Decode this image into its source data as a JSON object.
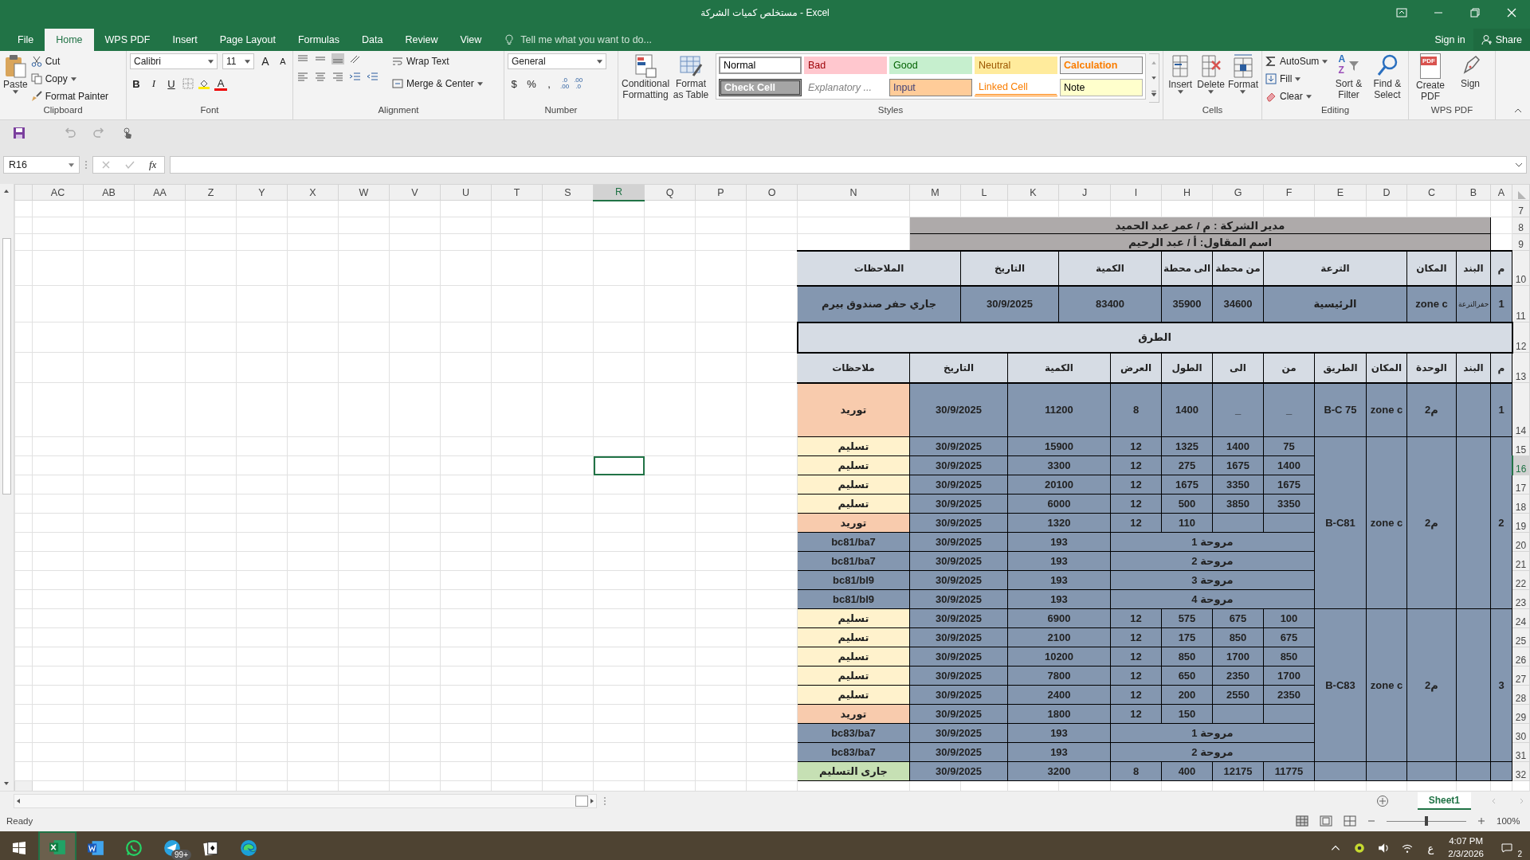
{
  "window": {
    "title": "مستخلص كميات الشركة - Excel"
  },
  "account": {
    "sign_in": "Sign in",
    "share": "Share"
  },
  "tabs": [
    {
      "label": "File",
      "selected": false
    },
    {
      "label": "Home",
      "selected": true
    },
    {
      "label": "WPS PDF",
      "selected": false
    },
    {
      "label": "Insert",
      "selected": false
    },
    {
      "label": "Page Layout",
      "selected": false
    },
    {
      "label": "Formulas",
      "selected": false
    },
    {
      "label": "Data",
      "selected": false
    },
    {
      "label": "Review",
      "selected": false
    },
    {
      "label": "View",
      "selected": false
    }
  ],
  "tell_me": {
    "placeholder": "Tell me what you want to do..."
  },
  "ribbon": {
    "clipboard": {
      "title": "Clipboard",
      "paste": "Paste",
      "cut": "Cut",
      "copy": "Copy",
      "format_painter": "Format Painter"
    },
    "font": {
      "title": "Font",
      "name": "Calibri",
      "size": "11",
      "grow_font": "A",
      "shrink_font": "A",
      "bold": "B",
      "italic": "I",
      "underline": "U",
      "font_color": "A"
    },
    "alignment": {
      "title": "Alignment",
      "wrap_text": "Wrap Text",
      "merge": "Merge & Center"
    },
    "number": {
      "title": "Number",
      "format": "General",
      "currency": "$",
      "percent": "%",
      "comma": ",",
      "increase_decimal": [
        ".0",
        ".00"
      ],
      "decrease_decimal": [
        ".00",
        ".0"
      ]
    },
    "styles": {
      "title": "Styles",
      "conditional": "Conditional Formatting",
      "format_table": "Format as Table",
      "gallery": [
        {
          "label": "Normal",
          "kind": "normal"
        },
        {
          "label": "Bad",
          "kind": "bad"
        },
        {
          "label": "Good",
          "kind": "good"
        },
        {
          "label": "Neutral",
          "kind": "neutral"
        },
        {
          "label": "Calculation",
          "kind": "calculation"
        },
        {
          "label": "Check Cell",
          "kind": "check"
        },
        {
          "label": "Explanatory ...",
          "kind": "explanatory"
        },
        {
          "label": "Input",
          "kind": "input"
        },
        {
          "label": "Linked Cell",
          "kind": "linked"
        },
        {
          "label": "Note",
          "kind": "note"
        }
      ]
    },
    "cells": {
      "title": "Cells",
      "buttons": [
        {
          "label": "Insert",
          "kind": "insert"
        },
        {
          "label": "Delete",
          "kind": "delete"
        },
        {
          "label": "Format",
          "kind": "format"
        }
      ]
    },
    "editing": {
      "title": "Editing",
      "autosum": "AutoSum",
      "fill": "Fill",
      "clear": "Clear",
      "sort_letters": [
        "A",
        "Z"
      ],
      "sort": "Sort & Filter",
      "find": "Find & Select"
    },
    "wps": {
      "title": "WPS PDF",
      "pdf_badge": "PDF",
      "create": "Create PDF",
      "sign": "Sign"
    }
  },
  "formula_bar": {
    "name_box": "R16",
    "function_label": "fx"
  },
  "columns": [
    {
      "label": "AC",
      "selected": false
    },
    {
      "label": "AB",
      "selected": false
    },
    {
      "label": "AA",
      "selected": false
    },
    {
      "label": "Z",
      "selected": false
    },
    {
      "label": "Y",
      "selected": false
    },
    {
      "label": "X",
      "selected": false
    },
    {
      "label": "W",
      "selected": false
    },
    {
      "label": "V",
      "selected": false
    },
    {
      "label": "U",
      "selected": false
    },
    {
      "label": "T",
      "selected": false
    },
    {
      "label": "S",
      "selected": false
    },
    {
      "label": "R",
      "selected": true
    },
    {
      "label": "Q",
      "selected": false
    },
    {
      "label": "P",
      "selected": false
    },
    {
      "label": "O",
      "selected": false
    },
    {
      "label": "N",
      "selected": false
    },
    {
      "label": "M",
      "selected": false
    },
    {
      "label": "L",
      "selected": false
    },
    {
      "label": "K",
      "selected": false
    },
    {
      "label": "J",
      "selected": false
    },
    {
      "label": "I",
      "selected": false
    },
    {
      "label": "H",
      "selected": false
    },
    {
      "label": "G",
      "selected": false
    },
    {
      "label": "F",
      "selected": false
    },
    {
      "label": "E",
      "selected": false
    },
    {
      "label": "D",
      "selected": false
    },
    {
      "label": "C",
      "selected": false
    },
    {
      "label": "B",
      "selected": false
    },
    {
      "label": "A",
      "selected": false
    }
  ],
  "rows": [
    {
      "number": "7",
      "selected": false
    },
    {
      "number": "8",
      "selected": false,
      "cells": [
        {
          "kind": "blank"
        },
        {
          "text": "مدير الشركة : م / عمر عبد الحميد",
          "kind": "title"
        },
        {
          "kind": "blank"
        }
      ]
    },
    {
      "number": "9",
      "selected": false,
      "cells": [
        {
          "kind": "blank"
        },
        {
          "text": "اسم المقاول: أ / عبد الرحيم",
          "kind": "title"
        },
        {
          "kind": "blank"
        }
      ]
    },
    {
      "number": "10",
      "selected": false,
      "cells": [
        {
          "text": "م",
          "kind": "head"
        },
        {
          "text": "البند",
          "kind": "head"
        },
        {
          "text": "المكان",
          "kind": "head"
        },
        {
          "text": "الترعة",
          "kind": "head"
        },
        {
          "text": "من محطة",
          "kind": "head"
        },
        {
          "text": "الى محطة",
          "kind": "head"
        },
        {
          "text": "الكمية",
          "kind": "head"
        },
        {
          "text": "التاريخ",
          "kind": "head"
        },
        {
          "text": "الملاحظات",
          "kind": "head"
        }
      ]
    },
    {
      "number": "11",
      "selected": false,
      "cells": [
        {
          "text": "جاري حفر صندوق بيرم",
          "kind": "data"
        },
        {
          "text": "30/9/2025",
          "kind": "data"
        },
        {
          "text": "83400",
          "kind": "data"
        },
        {
          "text": "35900",
          "kind": "data"
        },
        {
          "text": "34600",
          "kind": "data"
        },
        {
          "text": "الرئيسية",
          "kind": "data"
        },
        {
          "text": "zone c",
          "kind": "data"
        },
        {
          "text": "حفرالترعة",
          "kind": "data_small"
        },
        {
          "text": "1",
          "kind": "data"
        }
      ]
    },
    {
      "number": "12",
      "selected": false,
      "cells": [
        {
          "text": "الطرق",
          "kind": "section"
        }
      ]
    },
    {
      "number": "13",
      "selected": false,
      "cells": [
        {
          "text": "م",
          "kind": "head"
        },
        {
          "text": "البند",
          "kind": "head"
        },
        {
          "text": "الوحدة",
          "kind": "head"
        },
        {
          "text": "المكان",
          "kind": "head"
        },
        {
          "text": "الطريق",
          "kind": "head"
        },
        {
          "text": "من",
          "kind": "head"
        },
        {
          "text": "الى",
          "kind": "head"
        },
        {
          "text": "الطول",
          "kind": "head"
        },
        {
          "text": "العرض",
          "kind": "head"
        },
        {
          "text": "الكمية",
          "kind": "head"
        },
        {
          "text": "التاريخ",
          "kind": "head"
        },
        {
          "text": "ملاحظات",
          "kind": "head"
        }
      ]
    },
    {
      "number": "14",
      "selected": false,
      "cells": [
        {
          "text": "توريد",
          "kind": "supply"
        },
        {
          "text": "30/9/2025",
          "kind": "data"
        },
        {
          "text": "11200",
          "kind": "data"
        },
        {
          "text": "8",
          "kind": "data"
        },
        {
          "text": "1400",
          "kind": "data"
        },
        {
          "text": "_",
          "kind": "data"
        },
        {
          "text": "_",
          "kind": "data"
        },
        {
          "text": "B-C 75",
          "kind": "data"
        },
        {
          "text": "zone c",
          "kind": "data"
        },
        {
          "text": "م2",
          "kind": "data"
        },
        {
          "kind": "data"
        },
        {
          "text": "1",
          "kind": "data"
        }
      ]
    },
    {
      "number": "15",
      "selected": false,
      "cells": [
        {
          "text": "تسليم",
          "kind": "delivery"
        },
        {
          "text": "30/9/2025",
          "kind": "data"
        },
        {
          "text": "15900",
          "kind": "data"
        },
        {
          "text": "12",
          "kind": "data"
        },
        {
          "text": "1325",
          "kind": "data"
        },
        {
          "text": "1400",
          "kind": "data"
        },
        {
          "text": "75",
          "kind": "data"
        },
        {
          "text": "B-C81",
          "kind": "data"
        },
        {
          "text": "zone c",
          "kind": "data"
        },
        {
          "text": "م2",
          "kind": "data"
        },
        {
          "kind": "data"
        },
        {
          "text": "2",
          "kind": "data"
        }
      ]
    },
    {
      "number": "16",
      "selected": true,
      "cells": [
        {
          "text": "تسليم",
          "kind": "delivery"
        },
        {
          "text": "30/9/2025",
          "kind": "data"
        },
        {
          "text": "3300",
          "kind": "data"
        },
        {
          "text": "12",
          "kind": "data"
        },
        {
          "text": "275",
          "kind": "data"
        },
        {
          "text": "1675",
          "kind": "data"
        },
        {
          "text": "1400",
          "kind": "data"
        }
      ]
    },
    {
      "number": "17",
      "selected": false,
      "cells": [
        {
          "text": "تسليم",
          "kind": "delivery"
        },
        {
          "text": "30/9/2025",
          "kind": "data"
        },
        {
          "text": "20100",
          "kind": "data"
        },
        {
          "text": "12",
          "kind": "data"
        },
        {
          "text": "1675",
          "kind": "data"
        },
        {
          "text": "3350",
          "kind": "data"
        },
        {
          "text": "1675",
          "kind": "data"
        }
      ]
    },
    {
      "number": "18",
      "selected": false,
      "cells": [
        {
          "text": "تسليم",
          "kind": "delivery"
        },
        {
          "text": "30/9/2025",
          "kind": "data"
        },
        {
          "text": "6000",
          "kind": "data"
        },
        {
          "text": "12",
          "kind": "data"
        },
        {
          "text": "500",
          "kind": "data"
        },
        {
          "text": "3850",
          "kind": "data"
        },
        {
          "text": "3350",
          "kind": "data"
        }
      ]
    },
    {
      "number": "19",
      "selected": false,
      "cells": [
        {
          "text": "توريد",
          "kind": "supply"
        },
        {
          "text": "30/9/2025",
          "kind": "data"
        },
        {
          "text": "1320",
          "kind": "data"
        },
        {
          "text": "12",
          "kind": "data"
        },
        {
          "text": "110",
          "kind": "data"
        },
        {
          "kind": "data"
        },
        {
          "kind": "data"
        }
      ]
    },
    {
      "number": "20",
      "selected": false,
      "cells": [
        {
          "text": "bc81/ba7",
          "kind": "data"
        },
        {
          "text": "30/9/2025",
          "kind": "data"
        },
        {
          "text": "193",
          "kind": "data"
        },
        {
          "text": "مروحة 1",
          "kind": "data"
        }
      ]
    },
    {
      "number": "21",
      "selected": false,
      "cells": [
        {
          "text": "bc81/ba7",
          "kind": "data"
        },
        {
          "text": "30/9/2025",
          "kind": "data"
        },
        {
          "text": "193",
          "kind": "data"
        },
        {
          "text": "مروحة 2",
          "kind": "data"
        }
      ]
    },
    {
      "number": "22",
      "selected": false,
      "cells": [
        {
          "text": "bc81/bl9",
          "kind": "data"
        },
        {
          "text": "30/9/2025",
          "kind": "data"
        },
        {
          "text": "193",
          "kind": "data"
        },
        {
          "text": "مروحة 3",
          "kind": "data"
        }
      ]
    },
    {
      "number": "23",
      "selected": false,
      "cells": [
        {
          "text": "bc81/bl9",
          "kind": "data"
        },
        {
          "text": "30/9/2025",
          "kind": "data"
        },
        {
          "text": "193",
          "kind": "data"
        },
        {
          "text": "مروحة 4",
          "kind": "data"
        }
      ]
    },
    {
      "number": "24",
      "selected": false,
      "cells": [
        {
          "text": "تسليم",
          "kind": "delivery"
        },
        {
          "text": "30/9/2025",
          "kind": "data"
        },
        {
          "text": "6900",
          "kind": "data"
        },
        {
          "text": "12",
          "kind": "data"
        },
        {
          "text": "575",
          "kind": "data"
        },
        {
          "text": "675",
          "kind": "data"
        },
        {
          "text": "100",
          "kind": "data"
        },
        {
          "text": "B-C83",
          "kind": "data"
        },
        {
          "text": "zone c",
          "kind": "data"
        },
        {
          "text": "م2",
          "kind": "data"
        },
        {
          "kind": "data"
        },
        {
          "text": "3",
          "kind": "data"
        }
      ]
    },
    {
      "number": "25",
      "selected": false,
      "cells": [
        {
          "text": "تسليم",
          "kind": "delivery"
        },
        {
          "text": "30/9/2025",
          "kind": "data"
        },
        {
          "text": "2100",
          "kind": "data"
        },
        {
          "text": "12",
          "kind": "data"
        },
        {
          "text": "175",
          "kind": "data"
        },
        {
          "text": "850",
          "kind": "data"
        },
        {
          "text": "675",
          "kind": "data"
        }
      ]
    },
    {
      "number": "26",
      "selected": false,
      "cells": [
        {
          "text": "تسليم",
          "kind": "delivery"
        },
        {
          "text": "30/9/2025",
          "kind": "data"
        },
        {
          "text": "10200",
          "kind": "data"
        },
        {
          "text": "12",
          "kind": "data"
        },
        {
          "text": "850",
          "kind": "data"
        },
        {
          "text": "1700",
          "kind": "data"
        },
        {
          "text": "850",
          "kind": "data"
        }
      ]
    },
    {
      "number": "27",
      "selected": false,
      "cells": [
        {
          "text": "تسليم",
          "kind": "delivery"
        },
        {
          "text": "30/9/2025",
          "kind": "data"
        },
        {
          "text": "7800",
          "kind": "data"
        },
        {
          "text": "12",
          "kind": "data"
        },
        {
          "text": "650",
          "kind": "data"
        },
        {
          "text": "2350",
          "kind": "data"
        },
        {
          "text": "1700",
          "kind": "data"
        }
      ]
    },
    {
      "number": "28",
      "selected": false,
      "cells": [
        {
          "text": "تسليم",
          "kind": "delivery"
        },
        {
          "text": "30/9/2025",
          "kind": "data"
        },
        {
          "text": "2400",
          "kind": "data"
        },
        {
          "text": "12",
          "kind": "data"
        },
        {
          "text": "200",
          "kind": "data"
        },
        {
          "text": "2550",
          "kind": "data"
        },
        {
          "text": "2350",
          "kind": "data"
        }
      ]
    },
    {
      "number": "29",
      "selected": false,
      "cells": [
        {
          "text": "توريد",
          "kind": "supply"
        },
        {
          "text": "30/9/2025",
          "kind": "data"
        },
        {
          "text": "1800",
          "kind": "data"
        },
        {
          "text": "12",
          "kind": "data"
        },
        {
          "text": "150",
          "kind": "data"
        },
        {
          "kind": "data"
        },
        {
          "kind": "data"
        }
      ]
    },
    {
      "number": "30",
      "selected": false,
      "cells": [
        {
          "text": "bc83/ba7",
          "kind": "data"
        },
        {
          "text": "30/9/2025",
          "kind": "data"
        },
        {
          "text": "193",
          "kind": "data"
        },
        {
          "text": "مروحة 1",
          "kind": "data"
        }
      ]
    },
    {
      "number": "31",
      "selected": false,
      "cells": [
        {
          "text": "bc83/ba7",
          "kind": "data"
        },
        {
          "text": "30/9/2025",
          "kind": "data"
        },
        {
          "text": "193",
          "kind": "data"
        },
        {
          "text": "مروحة 2",
          "kind": "data"
        }
      ]
    },
    {
      "number": "32",
      "selected": false,
      "cells": [
        {
          "text": "جارى التسليم",
          "kind": "ongoing"
        },
        {
          "text": "30/9/2025",
          "kind": "data"
        },
        {
          "text": "3200",
          "kind": "data"
        },
        {
          "text": "8",
          "kind": "data"
        },
        {
          "text": "400",
          "kind": "data"
        },
        {
          "text": "12175",
          "kind": "data"
        },
        {
          "text": "11775",
          "kind": "data"
        },
        {
          "kind": "data"
        },
        {
          "kind": "data"
        },
        {
          "kind": "data"
        },
        {
          "kind": "data"
        },
        {
          "kind": "data"
        }
      ]
    }
  ],
  "sheet_tabs": [
    {
      "label": "Sheet1",
      "selected": true
    }
  ],
  "status_bar": {
    "status": "Ready",
    "zoom_slider": {
      "level": 0.5
    },
    "zoom": "100%"
  },
  "taskbar": {
    "badge": "99+",
    "language": "ع",
    "time": "4:07 PM",
    "date": "2/3/2026",
    "notifications": "2"
  }
}
